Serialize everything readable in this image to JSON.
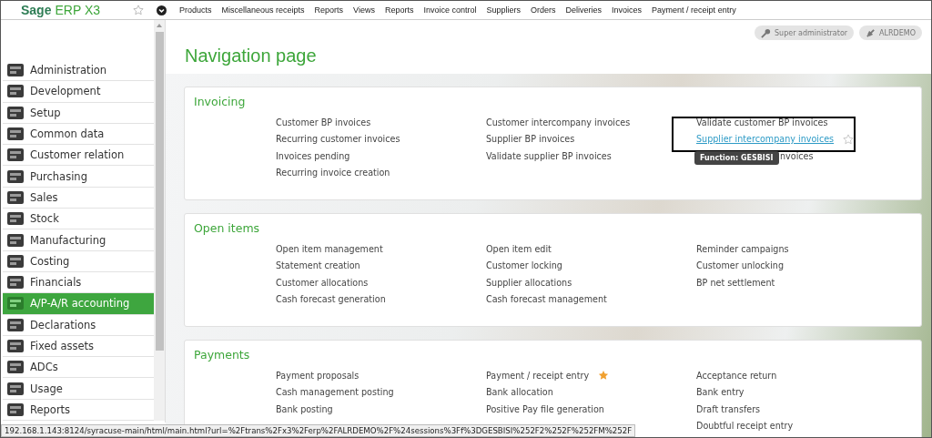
{
  "header": {
    "logo_brand": "Sage",
    "logo_product": "ERP X3",
    "menu": [
      "Products",
      "Miscellaneous receipts",
      "Reports",
      "Views",
      "Reports",
      "Invoice control",
      "Suppliers",
      "Orders",
      "Deliveries",
      "Invoices",
      "Payment / receipt entry"
    ]
  },
  "user_badges": [
    {
      "kind": "role",
      "label": "Super administrator"
    },
    {
      "kind": "folder",
      "label": "ALRDEMO"
    }
  ],
  "sidebar": {
    "items": [
      {
        "label": "Administration",
        "selected": false
      },
      {
        "label": "Development",
        "selected": false
      },
      {
        "label": "Setup",
        "selected": false
      },
      {
        "label": "Common data",
        "selected": false
      },
      {
        "label": "Customer relation",
        "selected": false
      },
      {
        "label": "Purchasing",
        "selected": false
      },
      {
        "label": "Sales",
        "selected": false
      },
      {
        "label": "Stock",
        "selected": false
      },
      {
        "label": "Manufacturing",
        "selected": false
      },
      {
        "label": "Costing",
        "selected": false
      },
      {
        "label": "Financials",
        "selected": false
      },
      {
        "label": "A/P-A/R accounting",
        "selected": true
      },
      {
        "label": "Declarations",
        "selected": false
      },
      {
        "label": "Fixed assets",
        "selected": false
      },
      {
        "label": "ADCs",
        "selected": false
      },
      {
        "label": "Usage",
        "selected": false
      },
      {
        "label": "Reports",
        "selected": false
      }
    ]
  },
  "page_title": "Navigation page",
  "sections": [
    {
      "title": "Invoicing",
      "columns": [
        [
          {
            "label": "Customer BP invoices",
            "kind": "link",
            "hovered": false,
            "favorite": false
          },
          {
            "label": "Recurring customer invoices",
            "kind": "link",
            "hovered": false,
            "favorite": false
          },
          {
            "label": "Invoices pending",
            "kind": "link",
            "hovered": false,
            "favorite": false
          },
          {
            "label": "Recurring invoice creation",
            "kind": "link",
            "hovered": false,
            "favorite": false
          }
        ],
        [
          {
            "label": "Customer intercompany invoices",
            "kind": "link",
            "hovered": false,
            "favorite": false
          },
          {
            "label": "Supplier BP invoices",
            "kind": "link",
            "hovered": false,
            "favorite": false
          },
          {
            "label": "Validate supplier BP invoices",
            "kind": "link",
            "hovered": false,
            "favorite": false
          }
        ],
        [
          {
            "label": "Validate customer BP invoices",
            "kind": "link",
            "hovered": false,
            "favorite": false
          },
          {
            "label": "Supplier intercompany invoices",
            "kind": "link",
            "hovered": true,
            "favorite": false,
            "tooltip": "Function: GESBISI"
          },
          {
            "label": "nvoices",
            "kind": "fragment"
          }
        ]
      ]
    },
    {
      "title": "Open items",
      "columns": [
        [
          {
            "label": "Open item management",
            "kind": "link",
            "hovered": false,
            "favorite": false
          },
          {
            "label": "Statement creation",
            "kind": "link",
            "hovered": false,
            "favorite": false
          },
          {
            "label": "Customer allocations",
            "kind": "link",
            "hovered": false,
            "favorite": false
          },
          {
            "label": "Cash forecast generation",
            "kind": "link",
            "hovered": false,
            "favorite": false
          }
        ],
        [
          {
            "label": "Open item edit",
            "kind": "link",
            "hovered": false,
            "favorite": false
          },
          {
            "label": "Customer locking",
            "kind": "link",
            "hovered": false,
            "favorite": false
          },
          {
            "label": "Supplier allocations",
            "kind": "link",
            "hovered": false,
            "favorite": false
          },
          {
            "label": "Cash forecast management",
            "kind": "link",
            "hovered": false,
            "favorite": false
          }
        ],
        [
          {
            "label": "Reminder campaigns",
            "kind": "link",
            "hovered": false,
            "favorite": false
          },
          {
            "label": "Customer unlocking",
            "kind": "link",
            "hovered": false,
            "favorite": false
          },
          {
            "label": "BP net settlement",
            "kind": "link",
            "hovered": false,
            "favorite": false
          }
        ]
      ]
    },
    {
      "title": "Payments",
      "columns": [
        [
          {
            "label": "Payment proposals",
            "kind": "link",
            "hovered": false,
            "favorite": false
          },
          {
            "label": "Cash management posting",
            "kind": "link",
            "hovered": false,
            "favorite": false
          },
          {
            "label": "Bank posting",
            "kind": "link",
            "hovered": false,
            "favorite": false
          }
        ],
        [
          {
            "label": "Payment / receipt entry",
            "kind": "link",
            "hovered": false,
            "favorite": true
          },
          {
            "label": "Bank allocation",
            "kind": "link",
            "hovered": false,
            "favorite": false
          },
          {
            "label": "Positive Pay file generation",
            "kind": "link",
            "hovered": false,
            "favorite": false
          }
        ],
        [
          {
            "label": "Acceptance return",
            "kind": "link",
            "hovered": false,
            "favorite": false
          },
          {
            "label": "Bank entry",
            "kind": "link",
            "hovered": false,
            "favorite": false
          },
          {
            "label": "Draft transfers",
            "kind": "link",
            "hovered": false,
            "favorite": false
          },
          {
            "label": "Doubtful receipt entry",
            "kind": "link",
            "hovered": false,
            "favorite": false
          }
        ]
      ]
    }
  ],
  "status_url": "192.168.1.143:8124/syracuse-main/html/main.html?url=%2Ftrans%2Fx3%2Ferp%2FALRDEMO%2F%24sessions%3Ff%3DGESBISI%252F2%252F%252FM%252F"
}
